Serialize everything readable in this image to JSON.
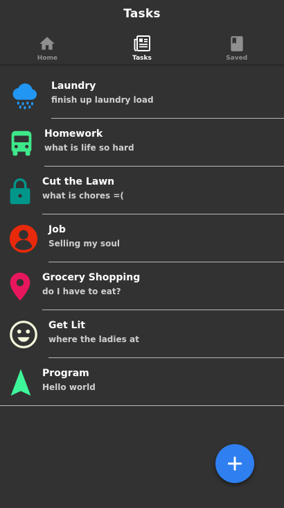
{
  "header": {
    "title": "Tasks"
  },
  "tabs": [
    {
      "label": "Home",
      "icon": "home-icon",
      "active": false
    },
    {
      "label": "Tasks",
      "icon": "newspaper-icon",
      "active": true
    },
    {
      "label": "Saved",
      "icon": "book-icon",
      "active": false
    }
  ],
  "tasks": [
    {
      "title": "Laundry",
      "subtitle": "finish up laundry load",
      "icon": "rain-cloud-icon",
      "color": "#2196f3"
    },
    {
      "title": "Homework",
      "subtitle": "what is life so hard",
      "icon": "bus-icon",
      "color": "#3ee88a"
    },
    {
      "title": "Cut the Lawn",
      "subtitle": "what is chores =(",
      "icon": "lock-icon",
      "color": "#00968a"
    },
    {
      "title": "Job",
      "subtitle": "Selling my soul",
      "icon": "person-icon",
      "color": "#e8290b"
    },
    {
      "title": "Grocery Shopping",
      "subtitle": "do I have to eat?",
      "icon": "map-pin-icon",
      "color": "#e8175d"
    },
    {
      "title": "Get Lit",
      "subtitle": "where the ladies at",
      "icon": "smiley-icon",
      "color": "#f5f7dc"
    },
    {
      "title": "Program",
      "subtitle": "Hello world",
      "icon": "navigation-arrow-icon",
      "color": "#3ef59a"
    }
  ],
  "fab": {
    "icon": "plus-icon",
    "color": "#2f7ff0"
  }
}
